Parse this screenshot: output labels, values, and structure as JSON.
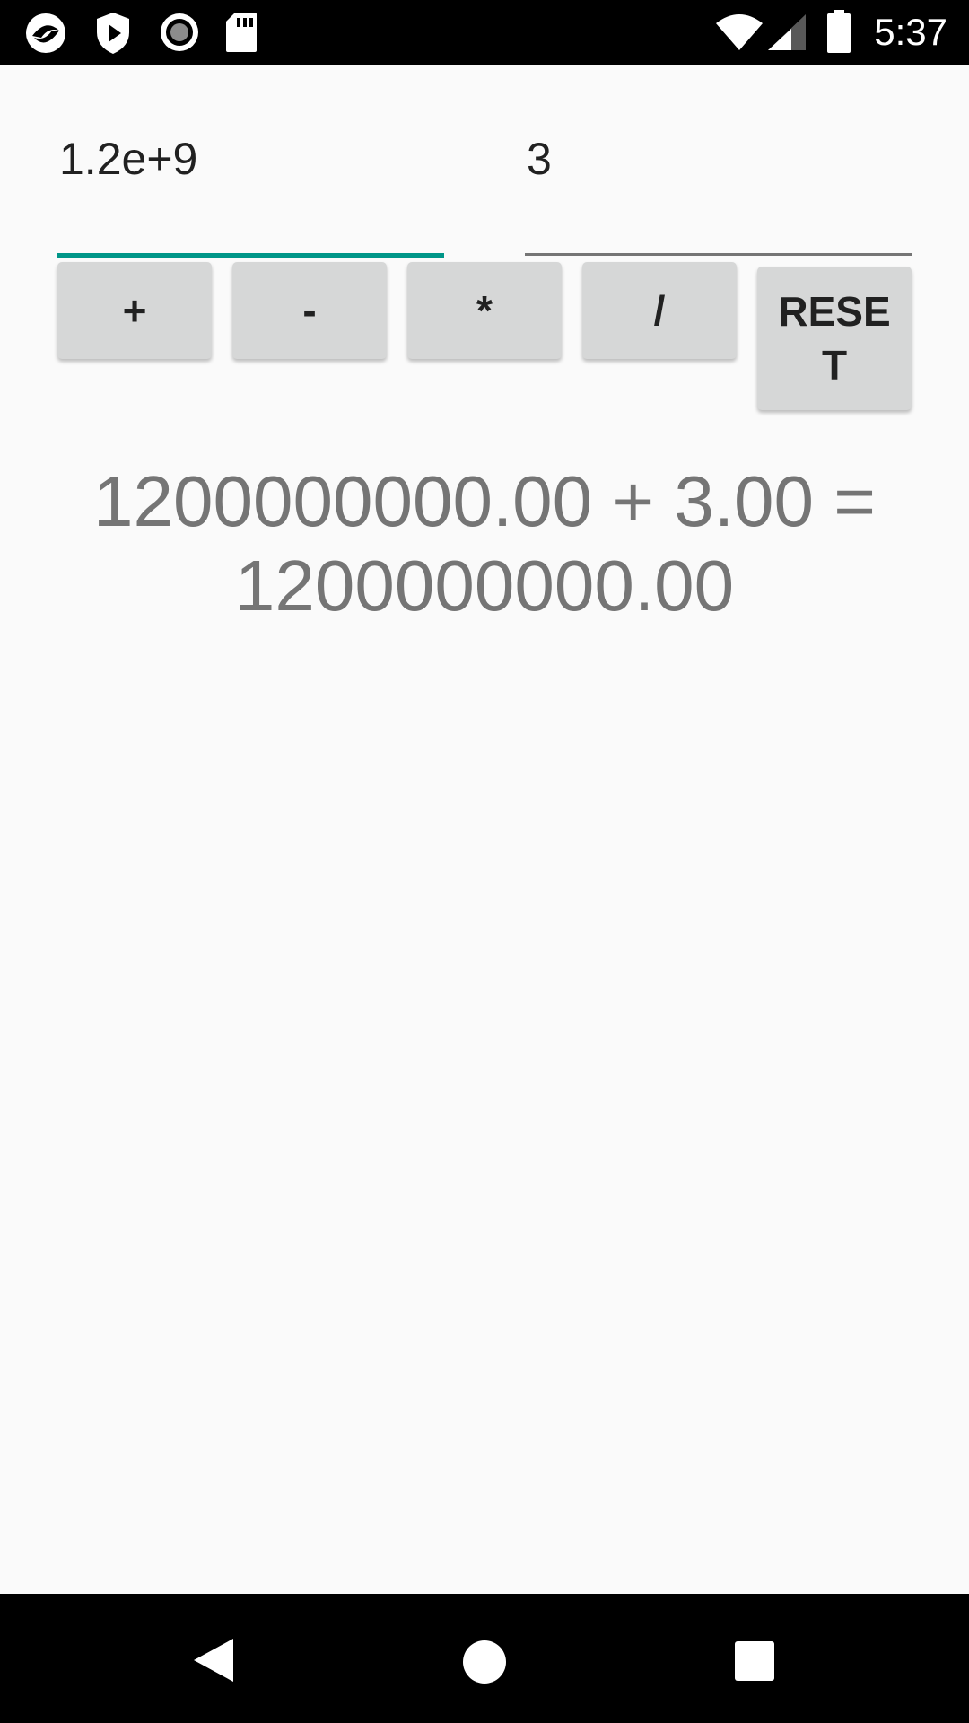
{
  "status_bar": {
    "time": "5:37",
    "left_icons": [
      "app-logo-icon",
      "shield-play-icon",
      "record-icon",
      "sd-card-icon"
    ],
    "right_icons": [
      "wifi-icon",
      "signal-icon",
      "battery-icon"
    ]
  },
  "calculator": {
    "operand1": "1.2e+9",
    "operand2": "3",
    "buttons": {
      "add": "+",
      "subtract": "-",
      "multiply": "*",
      "divide": "/",
      "reset": "RESET"
    },
    "result": "1200000000.00 + 3.00 = 1200000000.00"
  },
  "colors": {
    "accent": "#009688",
    "button_bg": "#d6d7d7",
    "result_text": "#757575"
  },
  "nav_bar": {
    "icons": [
      "back-icon",
      "home-icon",
      "recents-icon"
    ]
  }
}
